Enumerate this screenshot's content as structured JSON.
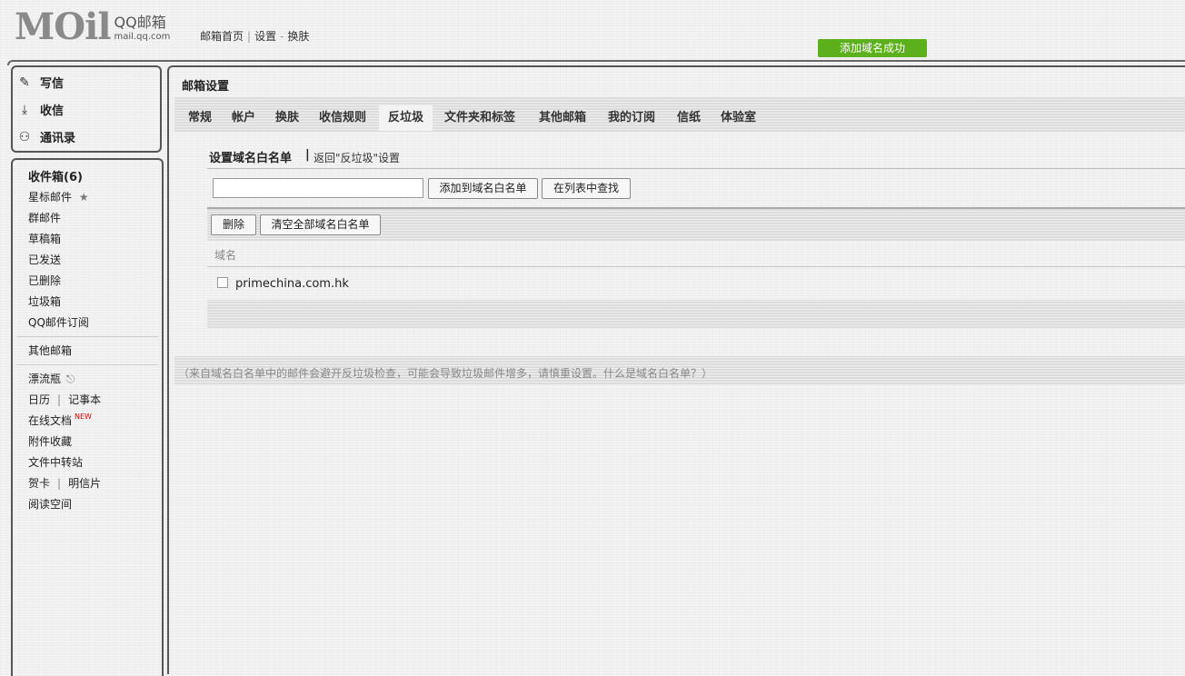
{
  "header": {
    "logo_mark": "MOil",
    "logo_title": "QQ邮箱",
    "logo_domain": "mail.qq.com",
    "nav": [
      "邮箱首页",
      "设置",
      "换肤"
    ],
    "nav_sep_1": "|",
    "nav_sep_2": "-",
    "toast": "添加域名成功"
  },
  "sidebar": {
    "compose": "写信",
    "receive": "收信",
    "contacts": "通讯录",
    "folders": {
      "inbox": "收件箱(6)",
      "starred": "星标邮件",
      "group": "群邮件",
      "drafts": "草稿箱",
      "sent": "已发送",
      "deleted": "已删除",
      "spam": "垃圾箱",
      "subscriptions": "QQ邮件订阅"
    },
    "other_mail": "其他邮箱",
    "apps": {
      "bottle": "漂流瓶",
      "calendar": "日历",
      "notes": "记事本",
      "docs": "在线文档",
      "docs_badge": "NEW",
      "attachments": "附件收藏",
      "transfer": "文件中转站",
      "cards": "贺卡",
      "postcards": "明信片",
      "reading": "阅读空间"
    }
  },
  "main": {
    "title": "邮箱设置",
    "tabs": [
      "常规",
      "帐户",
      "换肤",
      "收信规则",
      "反垃圾",
      "文件夹和标签",
      "其他邮箱",
      "我的订阅",
      "信纸",
      "体验室"
    ],
    "active_tab": "反垃圾",
    "section_title": "设置域名白名单",
    "section_sep": "|",
    "back_link": "返回\"反垃圾\"设置",
    "input_value": "",
    "add_button": "添加到域名白名单",
    "find_button": "在列表中查找",
    "delete_button": "删除",
    "clear_button": "清空全部域名白名单",
    "column_header": "域名",
    "rows": [
      {
        "domain": "primechina.com.hk",
        "checked": false
      }
    ],
    "note": "（来自域名白名单中的邮件会避开反垃圾检查，可能会导致垃圾邮件增多，请慎重设置。什么是域名白名单？）"
  }
}
